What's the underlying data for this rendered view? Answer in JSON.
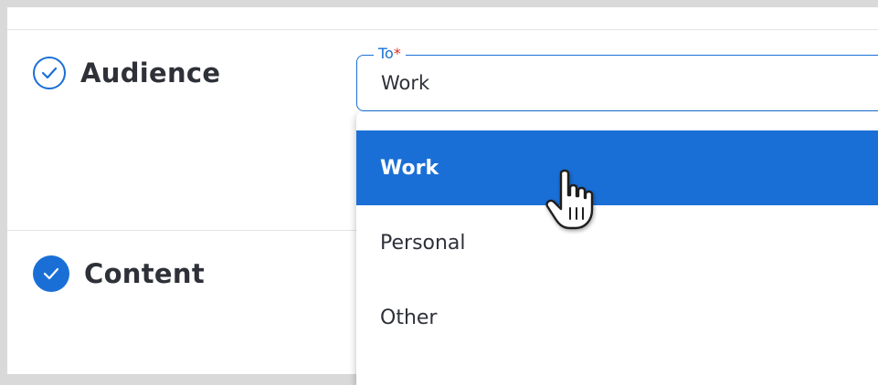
{
  "sections": {
    "audience": {
      "title": "Audience",
      "status_icon": "check-circle-outline-icon"
    },
    "content": {
      "title": "Content",
      "status_icon": "check-circle-filled-icon"
    }
  },
  "to_field": {
    "label": "To",
    "required_marker": "*",
    "value": "Work"
  },
  "dropdown": {
    "options": [
      {
        "label": "Work",
        "selected": true
      },
      {
        "label": "Personal",
        "selected": false
      },
      {
        "label": "Other",
        "selected": false
      }
    ]
  },
  "colors": {
    "accent": "#1a6fd6",
    "required": "#d93025",
    "text": "#2e3138"
  },
  "cursor_icon": "hand-pointer-icon"
}
